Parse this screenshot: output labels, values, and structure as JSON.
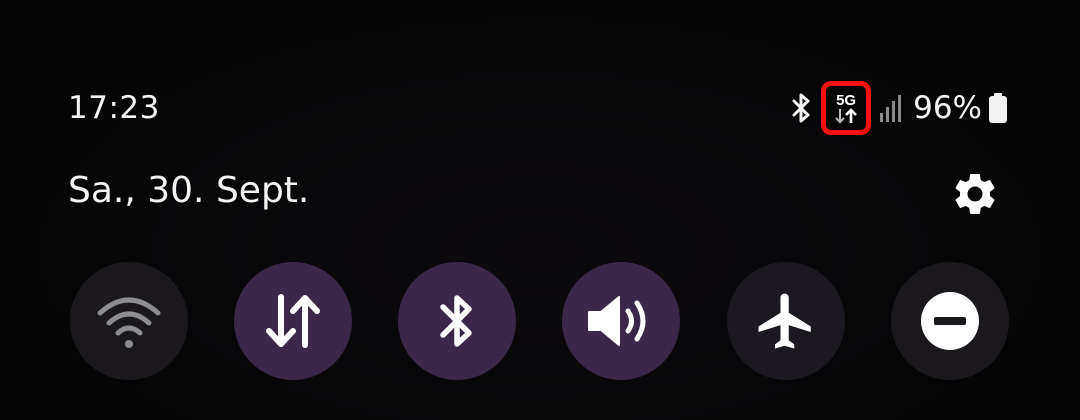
{
  "status_bar": {
    "time": "17:23",
    "network_type": "5G",
    "battery_percent": "96%",
    "icons": [
      "bluetooth-icon",
      "network-5g-icon",
      "signal-icon",
      "battery-icon"
    ],
    "highlight_color": "#ff1010"
  },
  "header": {
    "date": "Sa., 30. Sept.",
    "settings_icon": "gear-icon"
  },
  "quick_tiles": [
    {
      "name": "wifi",
      "icon": "wifi-icon",
      "state": "off"
    },
    {
      "name": "mobile-data",
      "icon": "data-transfer-icon",
      "state": "on"
    },
    {
      "name": "bluetooth",
      "icon": "bluetooth-icon",
      "state": "on"
    },
    {
      "name": "sound",
      "icon": "speaker-icon",
      "state": "on"
    },
    {
      "name": "airplane-mode",
      "icon": "airplane-icon",
      "state": "off"
    },
    {
      "name": "do-not-disturb",
      "icon": "minus-circle-icon",
      "state": "off"
    }
  ],
  "colors": {
    "tile_on": "#3b2849",
    "tile_off": "#1a181d",
    "background": "#050505"
  }
}
